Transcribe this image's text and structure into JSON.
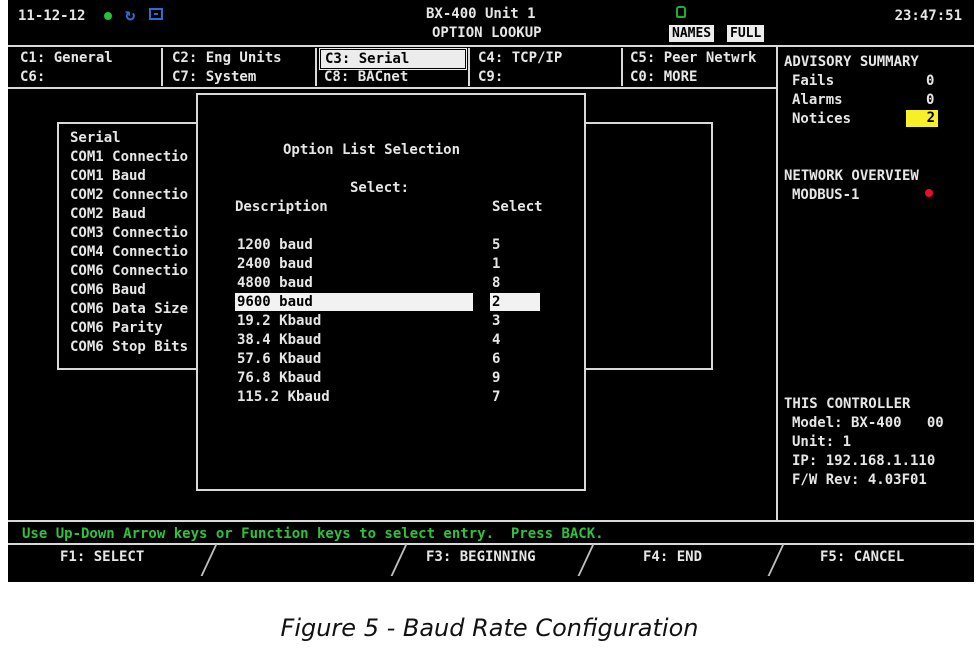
{
  "header": {
    "date": "11-12-12",
    "title_line1": "BX-400 Unit 1",
    "title_line2": "OPTION LOOKUP",
    "tag_names": "NAMES",
    "tag_full": "FULL",
    "time": "23:47:51"
  },
  "tabs": {
    "c1": "C1: General",
    "c2": "C2: Eng Units",
    "c3": "C3: Serial",
    "c4": "C4: TCP/IP",
    "c5": "C5: Peer Netwrk",
    "c6": "C6:",
    "c7": "C7: System",
    "c8": "C8: BACnet",
    "c9": "C9:",
    "c0": "C0: MORE"
  },
  "advisory": {
    "title": "ADVISORY SUMMARY",
    "fails_label": "Fails",
    "fails_value": "0",
    "alarms_label": "Alarms",
    "alarms_value": "0",
    "notices_label": "Notices",
    "notices_value": "2"
  },
  "network": {
    "title": "NETWORK OVERVIEW",
    "item": "MODBUS-1"
  },
  "controller": {
    "title": "THIS CONTROLLER",
    "model": "Model: BX-400   00",
    "unit": "Unit: 1",
    "ip": "IP: 192.168.1.110",
    "fw": "F/W Rev: 4.03F01"
  },
  "serial_list": [
    "Serial",
    "COM1 Connectio",
    "COM1 Baud",
    "COM2 Connectio",
    "COM2 Baud",
    "COM3 Connectio",
    "COM4 Connectio",
    "COM6 Connectio",
    "COM6 Baud",
    "COM6 Data Size",
    "COM6 Parity",
    "COM6 Stop Bits"
  ],
  "dialog": {
    "title": "Option List Selection",
    "select_prompt": "Select:",
    "col_desc": "Description",
    "col_select": "Select",
    "options": [
      {
        "desc": "1200 baud",
        "key": "5"
      },
      {
        "desc": "2400 baud",
        "key": "1"
      },
      {
        "desc": "4800 baud",
        "key": "8"
      },
      {
        "desc": "9600 baud",
        "key": "2"
      },
      {
        "desc": "19.2 Kbaud",
        "key": "3"
      },
      {
        "desc": "38.4 Kbaud",
        "key": "4"
      },
      {
        "desc": "57.6 Kbaud",
        "key": "6"
      },
      {
        "desc": "76.8 Kbaud",
        "key": "9"
      },
      {
        "desc": "115.2 Kbaud",
        "key": "7"
      }
    ],
    "selected_index": 3
  },
  "status_line": "Use Up-Down Arrow keys or Function keys to select entry.  Press BACK.",
  "fkeys": {
    "f1": "F1: SELECT",
    "f3": "F3: BEGINNING",
    "f4": "F4: END",
    "f5": "F5: CANCEL"
  },
  "caption": "Figure 5 - Baud Rate Configuration",
  "colors": {
    "screen_bg": "#000000",
    "text": "#e6e6e6",
    "status_green": "#31c23d",
    "notice_yellow": "#f7ef27",
    "alert_red": "#e3102a",
    "icon_blue": "#2e6bd4"
  }
}
